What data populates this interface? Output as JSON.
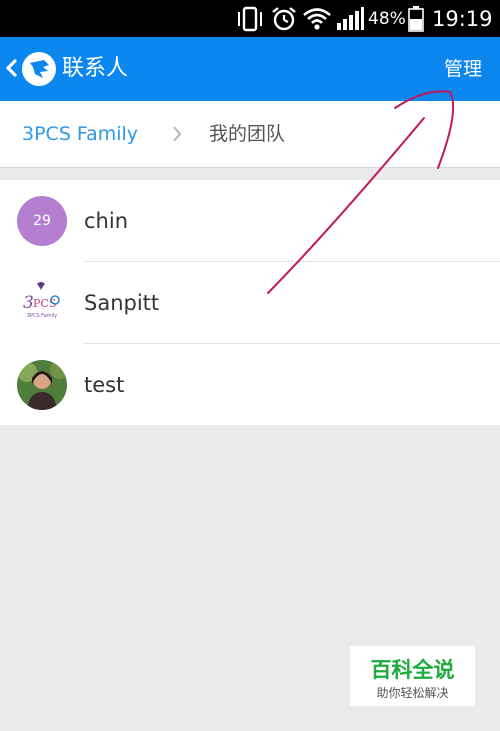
{
  "status_bar": {
    "battery_percent": "48%",
    "time": "19:19",
    "icons": [
      "vibrate-icon",
      "alarm-icon",
      "wifi-icon",
      "signal-icon",
      "battery-icon"
    ]
  },
  "app_bar": {
    "title": "联系人",
    "manage_label": "管理",
    "icons": [
      "back-icon",
      "app-logo-icon"
    ],
    "background": "#0d87f0"
  },
  "breadcrumb": {
    "root": "3PCS Family",
    "current": "我的团队",
    "root_color": "#2d98e8"
  },
  "contacts": [
    {
      "name": "chin",
      "badge": "29",
      "badge_color": "#b57fd1"
    },
    {
      "name": "Sanpitt",
      "avatar_text": "3PCS Family"
    },
    {
      "name": "test"
    }
  ],
  "watermark": {
    "main": "百科全说",
    "sub": "助你轻松解决",
    "color": "#1eaa3c"
  }
}
